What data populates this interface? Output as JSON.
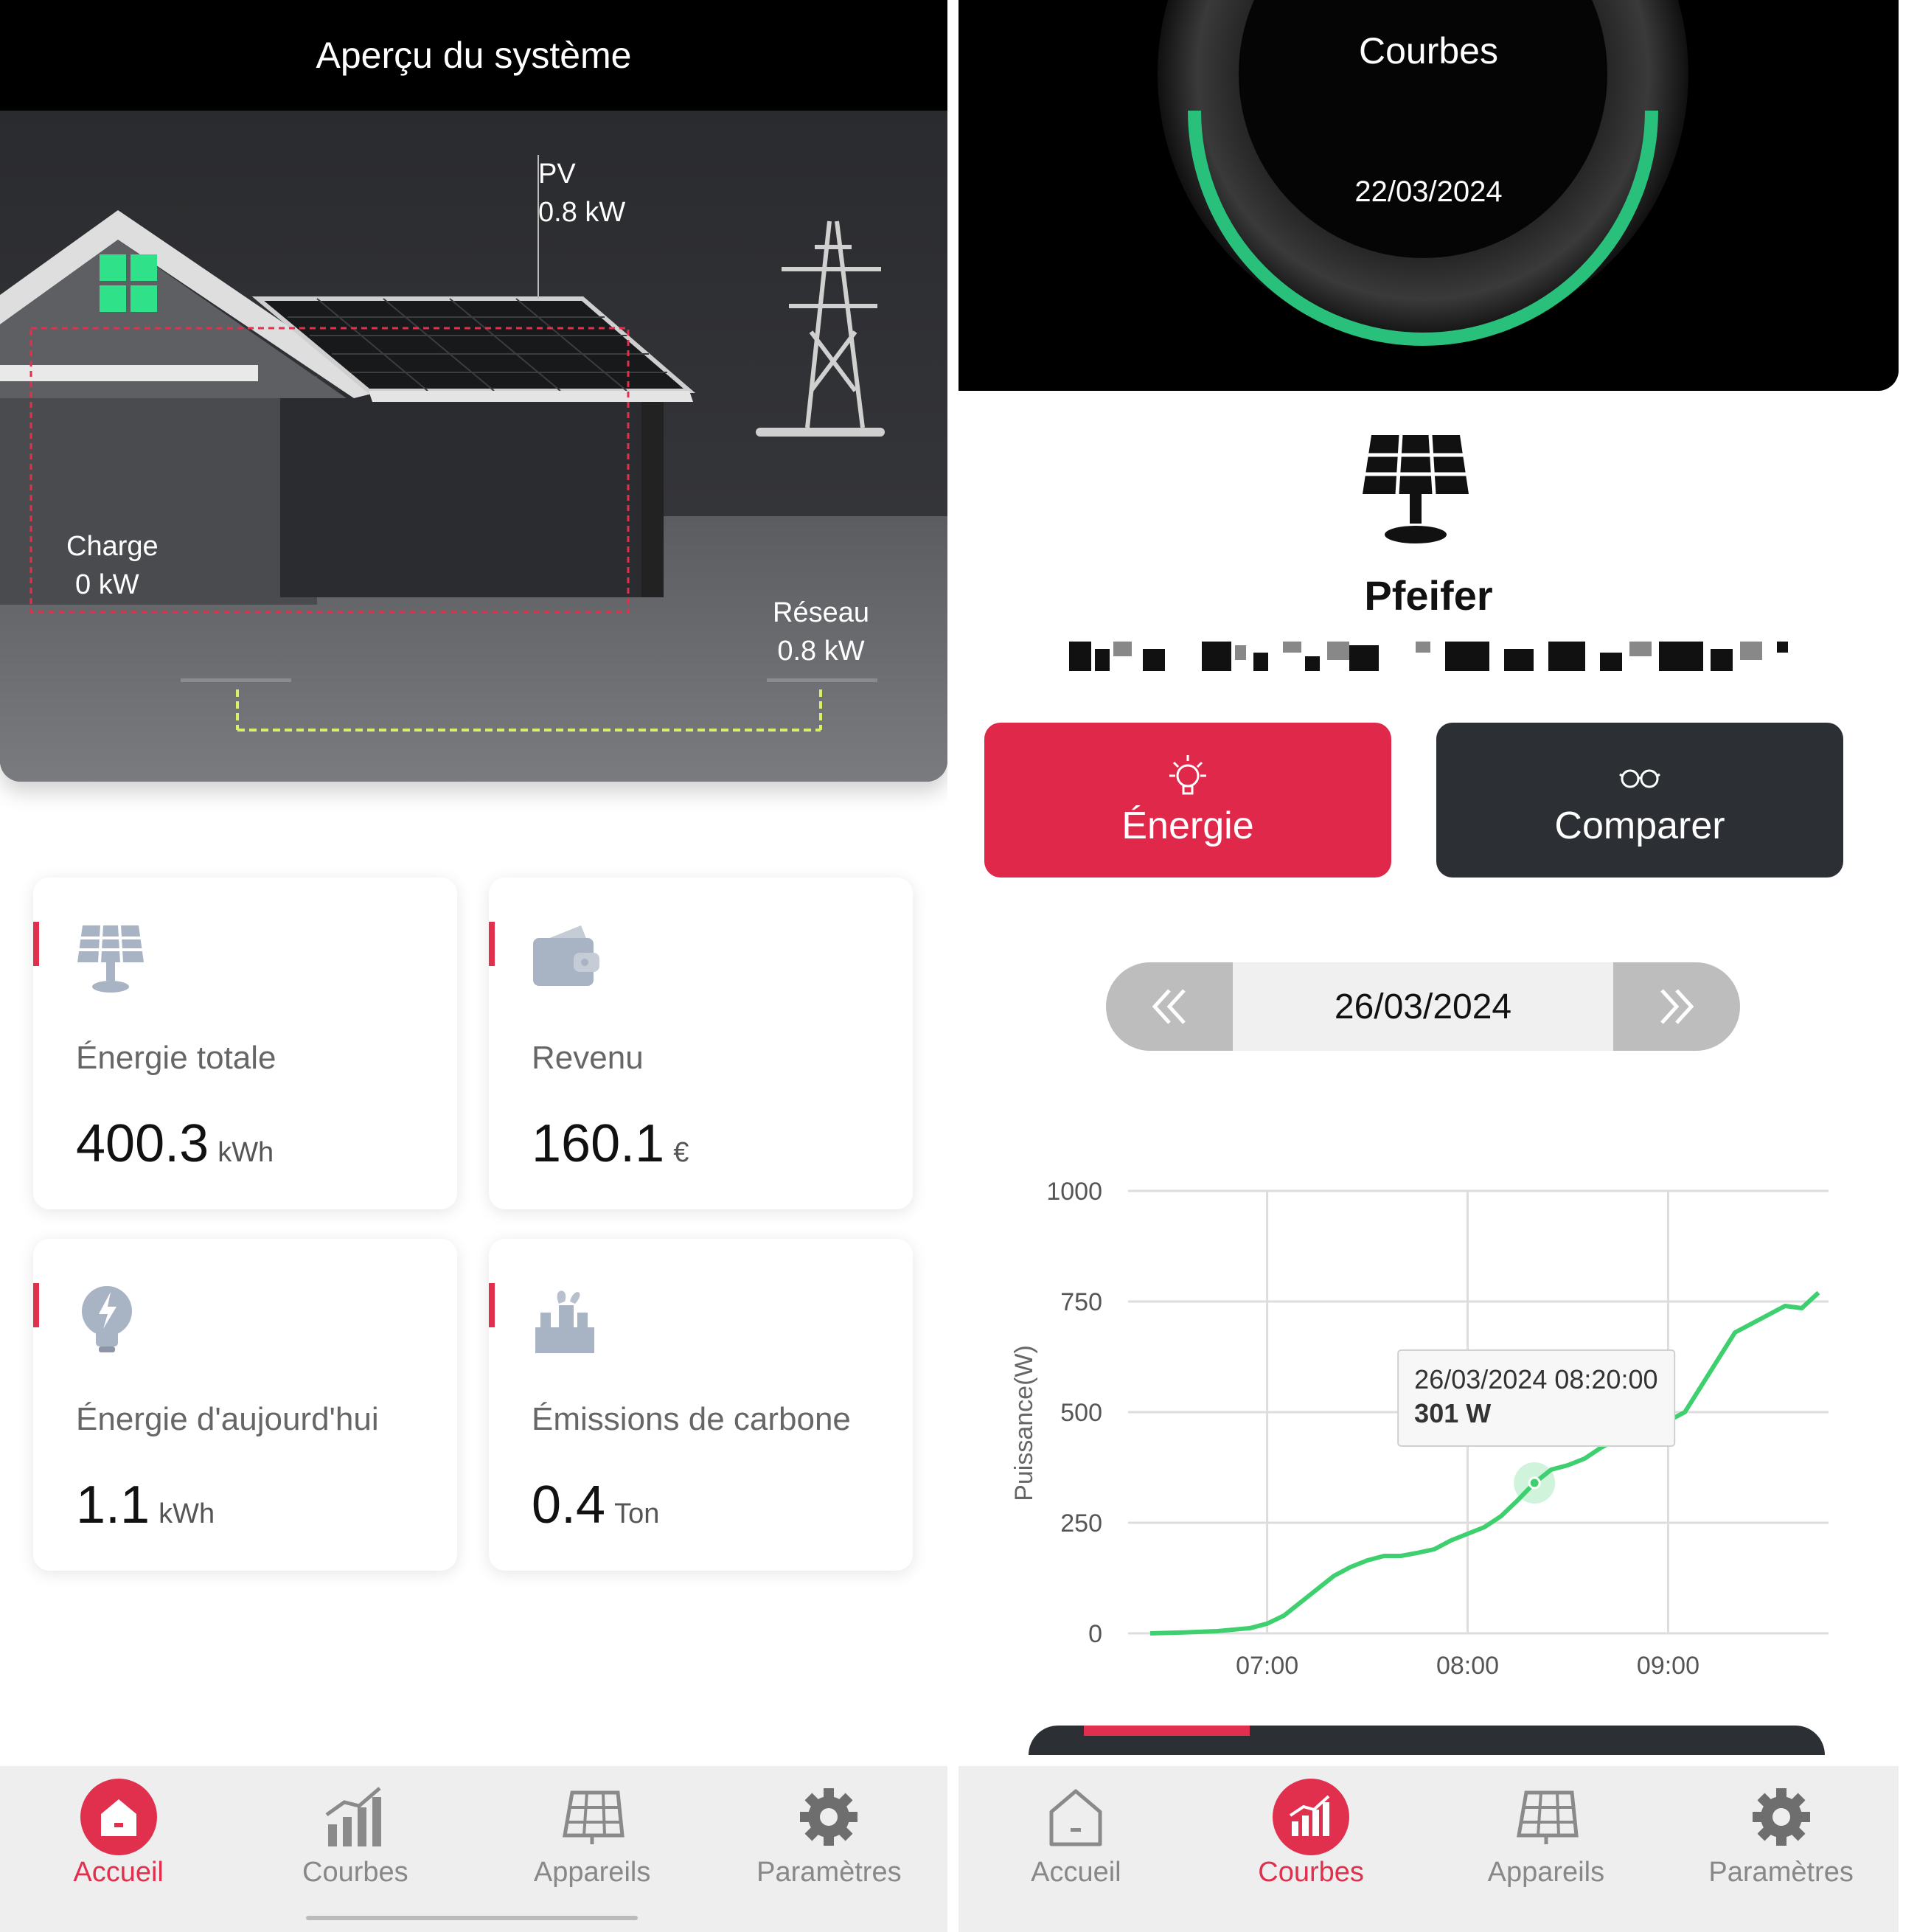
{
  "left": {
    "title": "Aperçu du système",
    "scene": {
      "pv_label": "PV",
      "pv_value": "0.8 kW",
      "load_label": "Charge",
      "load_value": "0 kW",
      "grid_label": "Réseau",
      "grid_value": "0.8 kW"
    },
    "cards": [
      {
        "label": "Énergie totale",
        "value": "400.3",
        "unit": "kWh",
        "icon": "solar-panel-icon"
      },
      {
        "label": "Revenu",
        "value": "160.1",
        "unit": "€",
        "icon": "wallet-icon"
      },
      {
        "label": "Énergie d'aujourd'hui",
        "value": "1.1",
        "unit": "kWh",
        "icon": "lightbulb-icon"
      },
      {
        "label": "Émissions de carbone",
        "value": "0.4",
        "unit": "Ton",
        "icon": "factory-icon"
      }
    ],
    "tabs": [
      {
        "label": "Accueil",
        "active": true
      },
      {
        "label": "Courbes",
        "active": false
      },
      {
        "label": "Appareils",
        "active": false
      },
      {
        "label": "Paramètres",
        "active": false
      }
    ]
  },
  "right": {
    "title": "Courbes",
    "gauge_date": "22/03/2024",
    "plant_name": "Pfeifer",
    "buttons": {
      "energy_label": "Énergie",
      "compare_label": "Comparer"
    },
    "date": "26/03/2024",
    "tabs": [
      {
        "label": "Accueil",
        "active": false
      },
      {
        "label": "Courbes",
        "active": true
      },
      {
        "label": "Appareils",
        "active": false
      },
      {
        "label": "Paramètres",
        "active": false
      }
    ]
  },
  "colors": {
    "accent": "#e0304e",
    "dark_button": "#2c2f33",
    "line": "#3ecf6e"
  },
  "chart_data": {
    "type": "line",
    "ylabel": "Puissance(W)",
    "xlabel": "",
    "ylim": [
      0,
      1000
    ],
    "yticks": [
      0,
      250,
      500,
      750,
      1000
    ],
    "xticks": [
      "07:00",
      "08:00",
      "09:00"
    ],
    "x": [
      "06:25",
      "06:35",
      "06:45",
      "06:55",
      "07:00",
      "07:05",
      "07:10",
      "07:15",
      "07:20",
      "07:25",
      "07:30",
      "07:35",
      "07:40",
      "07:45",
      "07:50",
      "07:55",
      "08:00",
      "08:05",
      "08:10",
      "08:15",
      "08:20",
      "08:25",
      "08:30",
      "08:35",
      "08:40",
      "08:45",
      "08:50",
      "08:55",
      "09:00",
      "09:05",
      "09:10",
      "09:15",
      "09:20",
      "09:25",
      "09:30",
      "09:35",
      "09:40",
      "09:45"
    ],
    "series": [
      {
        "values": [
          0,
          2,
          5,
          12,
          22,
          40,
          70,
          100,
          130,
          150,
          165,
          175,
          175,
          182,
          190,
          210,
          225,
          240,
          265,
          301,
          340,
          370,
          380,
          395,
          420,
          440,
          455,
          470,
          480,
          500,
          560,
          620,
          680,
          700,
          720,
          740,
          735,
          770
        ]
      }
    ],
    "tooltip": {
      "time": "26/03/2024 08:20:00",
      "value": "301 W"
    },
    "grid": true
  }
}
